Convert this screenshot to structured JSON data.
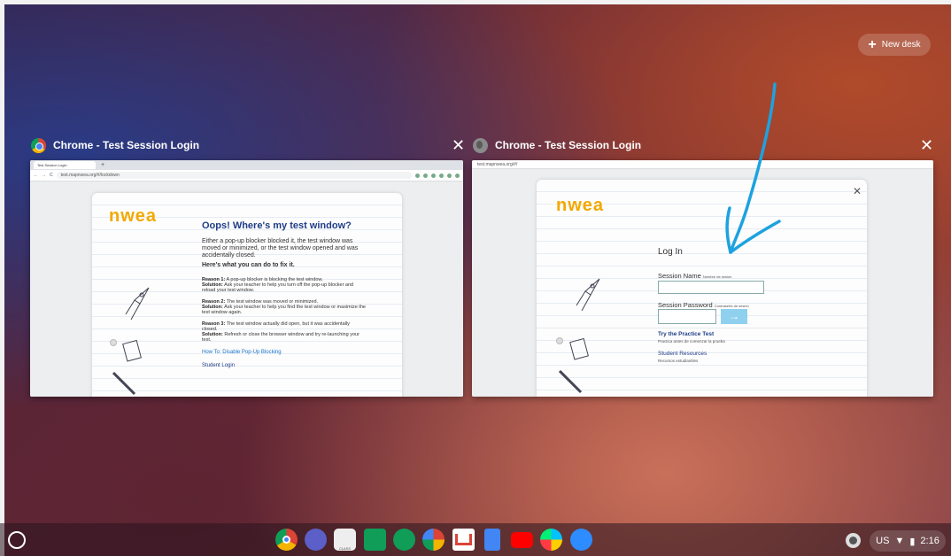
{
  "top_bar": {
    "new_desk_label": "New desk"
  },
  "windows": [
    {
      "title": "Chrome - Test Session Login",
      "icon": "chrome-icon",
      "tab_label": "Test Session Login",
      "url": "test.mapnwea.org/#/lockdown",
      "page": {
        "logo": "nwea",
        "heading": "Oops! Where's my test window?",
        "intro": "Either a pop-up blocker blocked it, the test window was moved or minimized, or the test window opened and was accidentally closed.",
        "subheading": "Here's what you can do to fix it.",
        "reasons": [
          {
            "reason_label": "Reason 1:",
            "reason": "A pop-up blocker is blocking the test window.",
            "solution_label": "Solution:",
            "solution": "Ask your teacher to help you turn off the pop-up blocker and reload your test window."
          },
          {
            "reason_label": "Reason 2:",
            "reason": "The test window was moved or minimized.",
            "solution_label": "Solution:",
            "solution": "Ask your teacher to help you find the test window or maximize the test window again."
          },
          {
            "reason_label": "Reason 3:",
            "reason": "The test window actually did open, but it was accidentally closed.",
            "solution_label": "Solution:",
            "solution": "Refresh or close the browser window and try re-launching your test."
          }
        ],
        "links": [
          "How To: Disable Pop-Up Blocking",
          "Student Login"
        ]
      }
    },
    {
      "title": "Chrome - Test Session Login",
      "icon": "globe-icon",
      "url": "test.mapnwea.org/#/",
      "page": {
        "logo": "nwea",
        "login_title": "Log In",
        "session_name_label": "Session Name",
        "session_name_sub": "Nombre de sesión",
        "session_password_label": "Session Password",
        "session_password_sub": "Contraseña de sesión",
        "submit_glyph": "→",
        "practice_title": "Try the Practice Test",
        "practice_sub": "Practica antes de comenzar la prueba",
        "resources_title": "Student Resources",
        "resources_sub": "Recursos estudiantiles"
      }
    }
  ],
  "shelf": {
    "apps": [
      "chrome-icon",
      "teams-icon",
      "class-icon",
      "classroom-icon",
      "hangouts-icon",
      "photos-icon",
      "gmail-icon",
      "docs-icon",
      "youtube-icon",
      "play-store-icon",
      "zoom-icon"
    ],
    "class_label": "CLASS",
    "status": {
      "locale": "US",
      "time": "2:16"
    }
  }
}
